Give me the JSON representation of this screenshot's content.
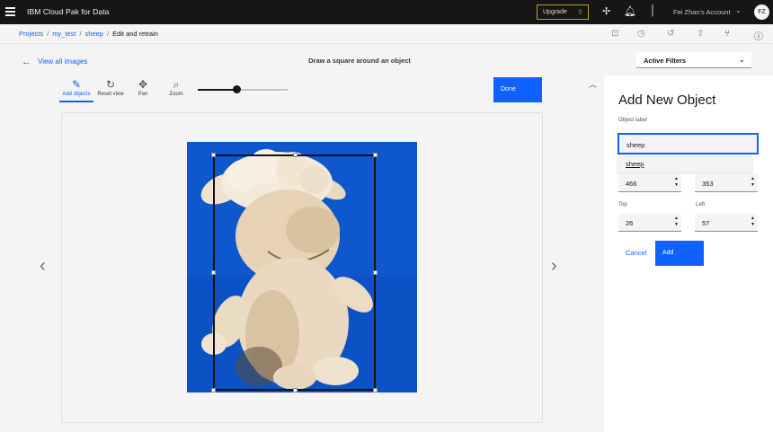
{
  "header": {
    "product": "IBM Cloud Pak for Data",
    "upgrade_label": "Upgrade",
    "account": "Fei Zhan's Account",
    "avatar_initials": "FZ"
  },
  "breadcrumb": {
    "items": [
      "Projects",
      "my_test",
      "sheep"
    ],
    "current": "Edit and retrain"
  },
  "main": {
    "view_all": "View all images",
    "instruction": "Draw a square around an object",
    "tools": [
      {
        "label": "Add objects",
        "icon": "pencil-icon"
      },
      {
        "label": "Reset view",
        "icon": "reset-icon"
      },
      {
        "label": "Pan",
        "icon": "pan-icon"
      },
      {
        "label": "Zoom",
        "icon": "zoom-icon"
      }
    ],
    "zoom_level": 0.43,
    "done_label": "Done",
    "image_subject": "sheep plush toy on blue background"
  },
  "panel": {
    "filter_label": "Active Filters",
    "title": "Add New Object",
    "object_label_caption": "Object label",
    "object_label_value": "sheep",
    "suggestion": "sheep",
    "width_value": "466",
    "height_value": "353",
    "top_label": "Top",
    "top_value": "26",
    "left_label": "Left",
    "left_value": "57",
    "cancel_label": "Cancel",
    "add_label": "Add"
  },
  "colors": {
    "accent": "#0f62fe",
    "header_bg": "#161616",
    "upgrade_border": "#c49a2a"
  }
}
